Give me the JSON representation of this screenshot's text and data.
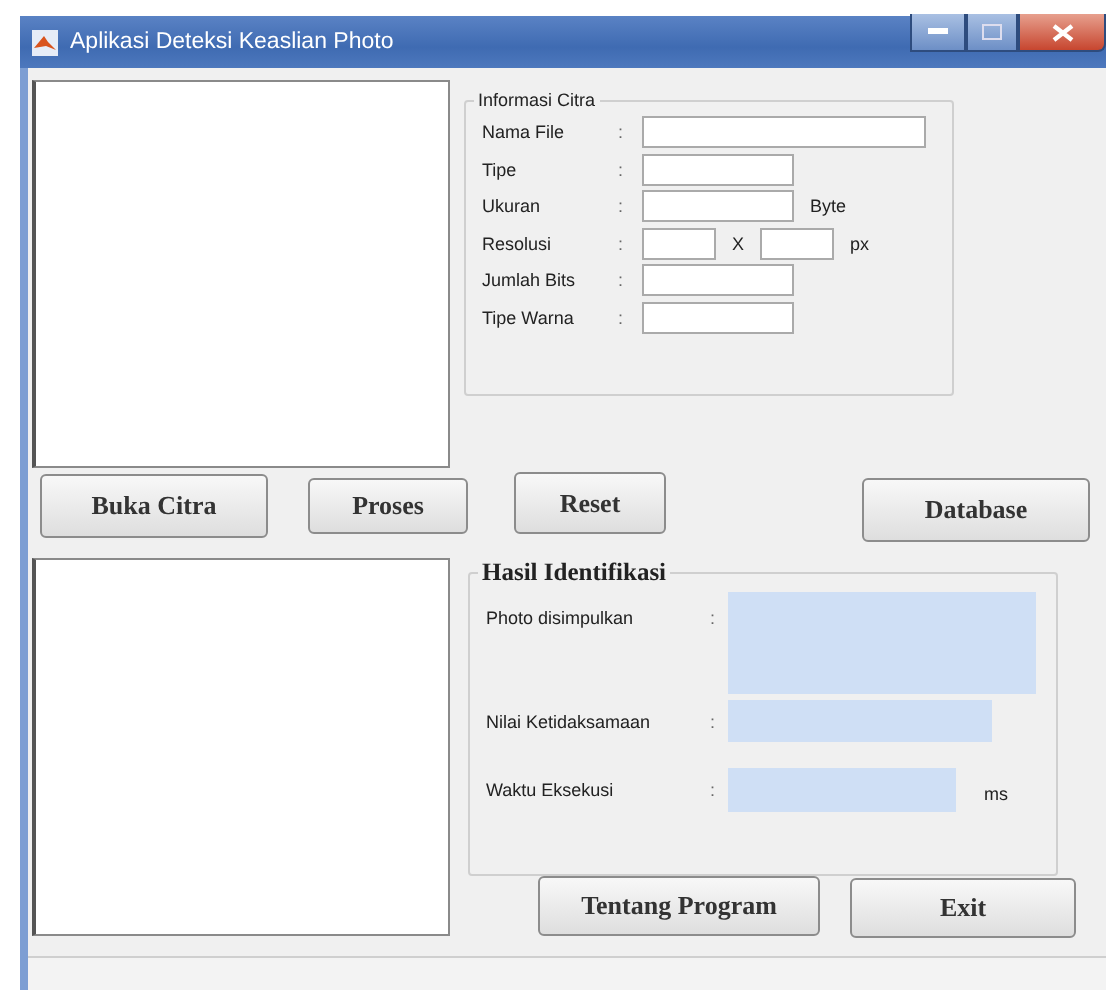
{
  "window": {
    "title": "Aplikasi Deteksi Keaslian Photo"
  },
  "info_panel": {
    "title": "Informasi Citra",
    "fields": [
      {
        "label": "Nama File",
        "colon": ":",
        "kind": "wide"
      },
      {
        "label": "Tipe",
        "colon": ":",
        "kind": "short"
      },
      {
        "label": "Ukuran",
        "colon": ":",
        "kind": "short",
        "unit": "Byte"
      },
      {
        "label": "Resolusi",
        "colon": ":",
        "kind": "pair",
        "separator": "X",
        "unit": "px"
      },
      {
        "label": "Jumlah Bits",
        "colon": ":",
        "kind": "short"
      },
      {
        "label": "Tipe Warna",
        "colon": ":",
        "kind": "short"
      }
    ]
  },
  "action_buttons": [
    "Buka Citra",
    "Proses",
    "Reset",
    "Database"
  ],
  "result_panel": {
    "title": "Hasil Identifikasi",
    "fields": [
      {
        "label": "Photo disimpulkan",
        "colon": ":",
        "kind": "large"
      },
      {
        "label": "Nilai Ketidaksamaan",
        "colon": ":",
        "kind": "medium"
      },
      {
        "label": "Waktu Eksekusi",
        "colon": ":",
        "kind": "short",
        "unit": "ms"
      }
    ]
  },
  "bottom_buttons": [
    "Tentang Program",
    "Exit"
  ]
}
